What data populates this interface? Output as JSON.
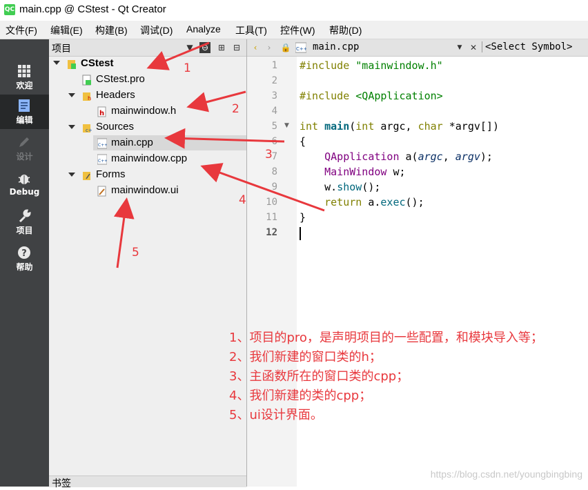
{
  "window": {
    "title": "main.cpp @ CStest - Qt Creator",
    "logo": "QC"
  },
  "menu": [
    "文件(F)",
    "编辑(E)",
    "构建(B)",
    "调试(D)",
    "Analyze",
    "工具(T)",
    "控件(W)",
    "帮助(D)"
  ],
  "modes": [
    {
      "label": "欢迎",
      "icon": "grid-icon"
    },
    {
      "label": "编辑",
      "icon": "edit-icon"
    },
    {
      "label": "设计",
      "icon": "pencil-icon"
    },
    {
      "label": "Debug",
      "icon": "bug-icon"
    },
    {
      "label": "项目",
      "icon": "wrench-icon"
    },
    {
      "label": "帮助",
      "icon": "help-icon"
    }
  ],
  "project_panel": {
    "title": "项目",
    "bottom_title": "书签",
    "tree": {
      "project": "CStest",
      "pro_file": "CStest.pro",
      "headers": "Headers",
      "header_file": "mainwindow.h",
      "sources": "Sources",
      "source_main": "main.cpp",
      "source_window": "mainwindow.cpp",
      "forms": "Forms",
      "form_file": "mainwindow.ui"
    }
  },
  "editor": {
    "tab_file": "main.cpp",
    "symbol": "<Select Symbol>",
    "line_numbers": [
      "1",
      "2",
      "3",
      "4",
      "5",
      "6",
      "7",
      "8",
      "9",
      "10",
      "11",
      "12"
    ],
    "current_line": "12"
  },
  "annotations": [
    "1",
    "2",
    "3",
    "4",
    "5"
  ],
  "notes": [
    "1、项目的pro，是声明项目的一些配置，和模块导入等；",
    "2、我们新建的窗口类的h；",
    "3、主函数所在的窗口类的cpp；",
    "4、我们新建的类的cpp；",
    "5、ui设计界面。"
  ],
  "watermark": "https://blog.csdn.net/youngbingbing",
  "colors": {
    "annotation": "#e8383d",
    "sidebar": "#404244",
    "sidebar_active": "#262829"
  }
}
